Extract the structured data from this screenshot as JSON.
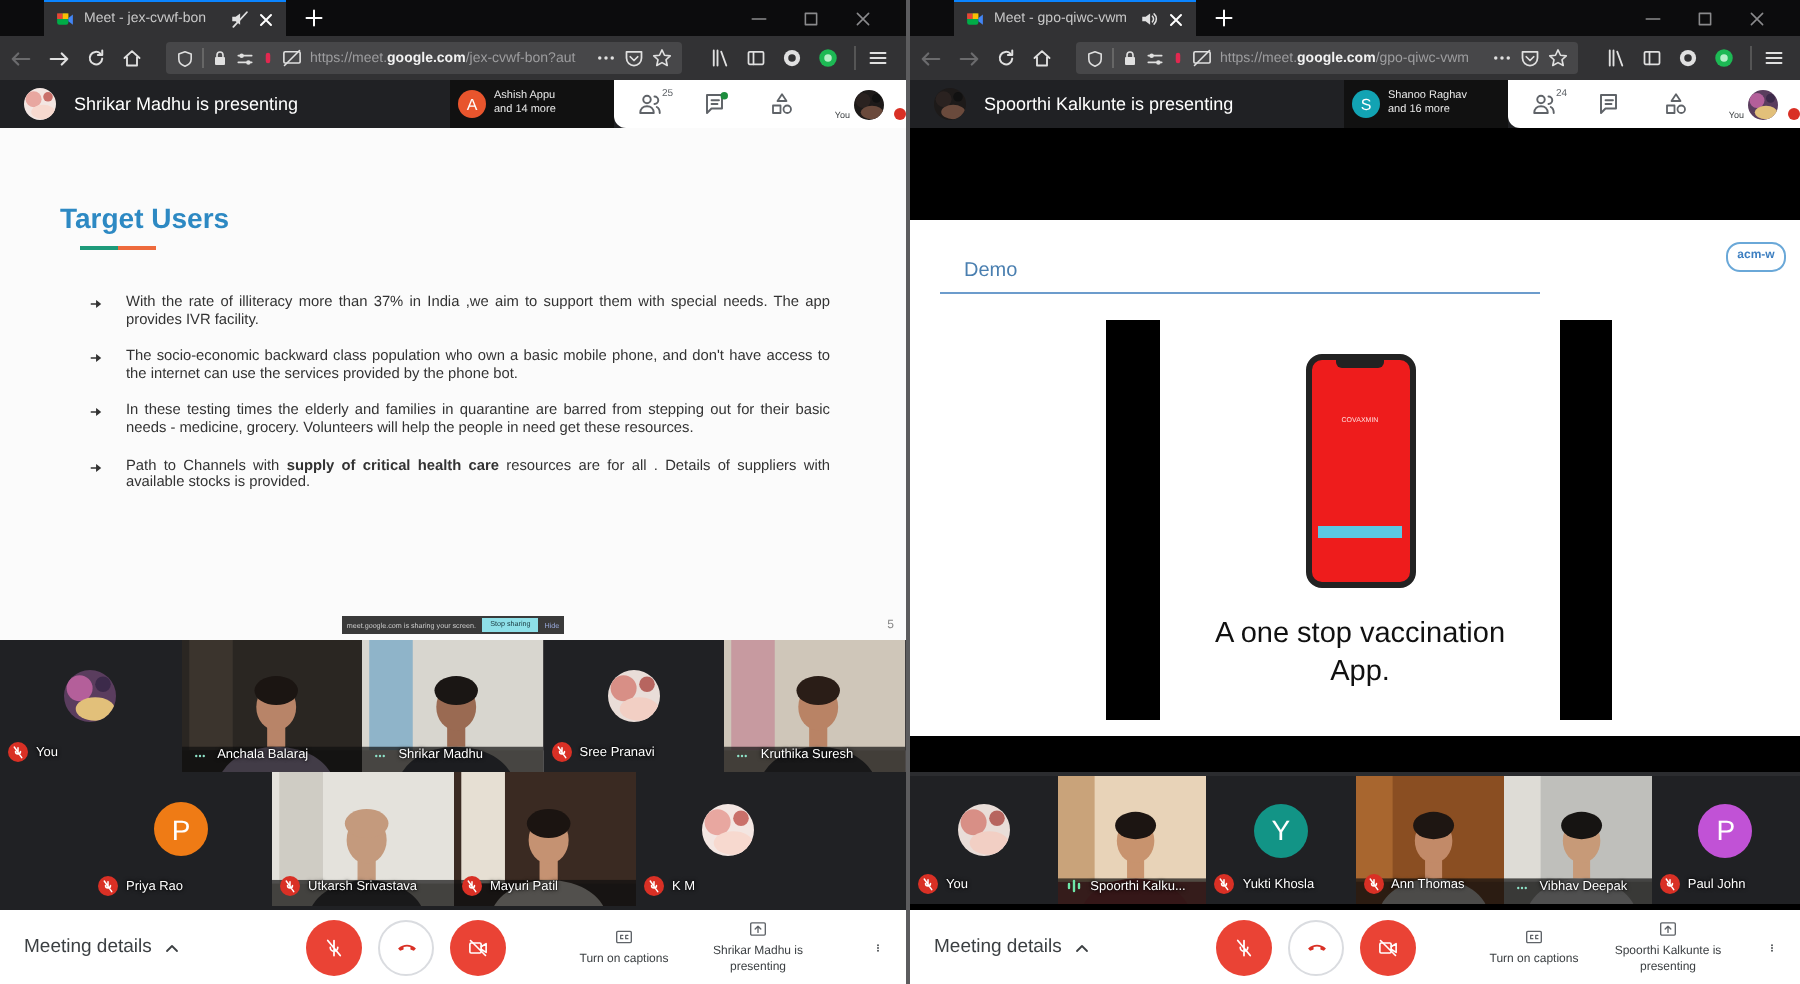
{
  "windows": [
    {
      "tab": {
        "title": "Meet - jex-cvwf-bon",
        "muted": true
      },
      "nav": {
        "back_enabled": false,
        "forward_enabled": true,
        "url": "https://meet.**google.com**/jex-cvwf-bon?aut"
      },
      "header": {
        "presenter": "Shrikar Madhu is presenting",
        "joined": {
          "letter": "A",
          "color": "#e8552d",
          "name": "Ashish Appu",
          "more": "and 14 more"
        },
        "people_count": "25",
        "chat_unread": true,
        "self_label": "You"
      },
      "stage": {
        "kind": "bullets",
        "title": "Target Users",
        "bullets": [
          "With the rate of illiteracy more than 37% in India ,we aim to support them with special needs. The app provides IVR facility.",
          "The socio-economic backward class population who own a basic mobile phone, and don't have access to the internet can use the services provided by the phone bot.",
          "In these testing times the elderly and families in quarantine are barred from stepping out for their basic needs - medicine, grocery. Volunteers will help the people in need get these resources.",
          "Path to Channels with **supply of critical health care** resources are for all . Details of suppliers with available stocks is provided."
        ],
        "page": "5",
        "share_bar": {
          "message": "meet.google.com is sharing your screen.",
          "stop": "Stop sharing",
          "hide": "Hide"
        }
      },
      "participant_rows": [
        [
          {
            "name": "You",
            "muted": true
          },
          {
            "name": "Anchala Balaraj",
            "kind": "video",
            "muted": false,
            "speaking": false
          },
          {
            "name": "Shrikar Madhu",
            "kind": "video",
            "muted": false,
            "speaking": false
          },
          {
            "name": "Sree Pranavi",
            "muted": true
          },
          {
            "name": "Kruthika Suresh",
            "kind": "video",
            "muted": false,
            "speaking": false
          }
        ],
        [
          {
            "name": "Priya Rao",
            "kind": "letter",
            "letter": "P",
            "color": "#ef7b15",
            "muted": true
          },
          {
            "name": "Utkarsh Srivastava",
            "kind": "video",
            "muted": true
          },
          {
            "name": "Mayuri Patil",
            "kind": "video",
            "muted": true
          },
          {
            "name": "K M",
            "muted": true
          }
        ]
      ],
      "controls": {
        "details": "Meeting details",
        "captions": "Turn on captions",
        "presenting": "Shrikar Madhu is presenting"
      }
    },
    {
      "tab": {
        "title": "Meet - gpo-qiwc-vwm",
        "muted": false
      },
      "nav": {
        "back_enabled": false,
        "forward_enabled": false,
        "url": "https://meet.**google.com**/gpo-qiwc-vwm"
      },
      "header": {
        "presenter": "Spoorthi Kalkunte is presenting",
        "joined": {
          "letter": "S",
          "color": "#12a3b3",
          "name": "Shanoo Raghav",
          "more": "and 16 more"
        },
        "people_count": "24",
        "chat_unread": false,
        "self_label": "You"
      },
      "stage": {
        "kind": "demo",
        "title": "Demo",
        "logo": "acm-w",
        "app_name": "COVAXMIN",
        "caption": "A one stop vaccination App."
      },
      "participant_rows": [
        [
          {
            "name": "You",
            "muted": true
          },
          {
            "name": "Spoorthi Kalku...",
            "kind": "video",
            "muted": false,
            "speaking": true
          },
          {
            "name": "Yukti Khosla",
            "kind": "letter",
            "letter": "Y",
            "color": "#129486",
            "muted": true
          },
          {
            "name": "Ann Thomas",
            "kind": "video",
            "muted": true
          },
          {
            "name": "Vibhav Deepak",
            "kind": "video",
            "muted": false,
            "speaking": false
          },
          {
            "name": "Paul John",
            "kind": "letter",
            "letter": "P",
            "color": "#c152d6",
            "muted": true
          }
        ]
      ],
      "controls": {
        "details": "Meeting details",
        "captions": "Turn on captions",
        "presenting": "Spoorthi Kalkunte is presenting"
      }
    }
  ]
}
